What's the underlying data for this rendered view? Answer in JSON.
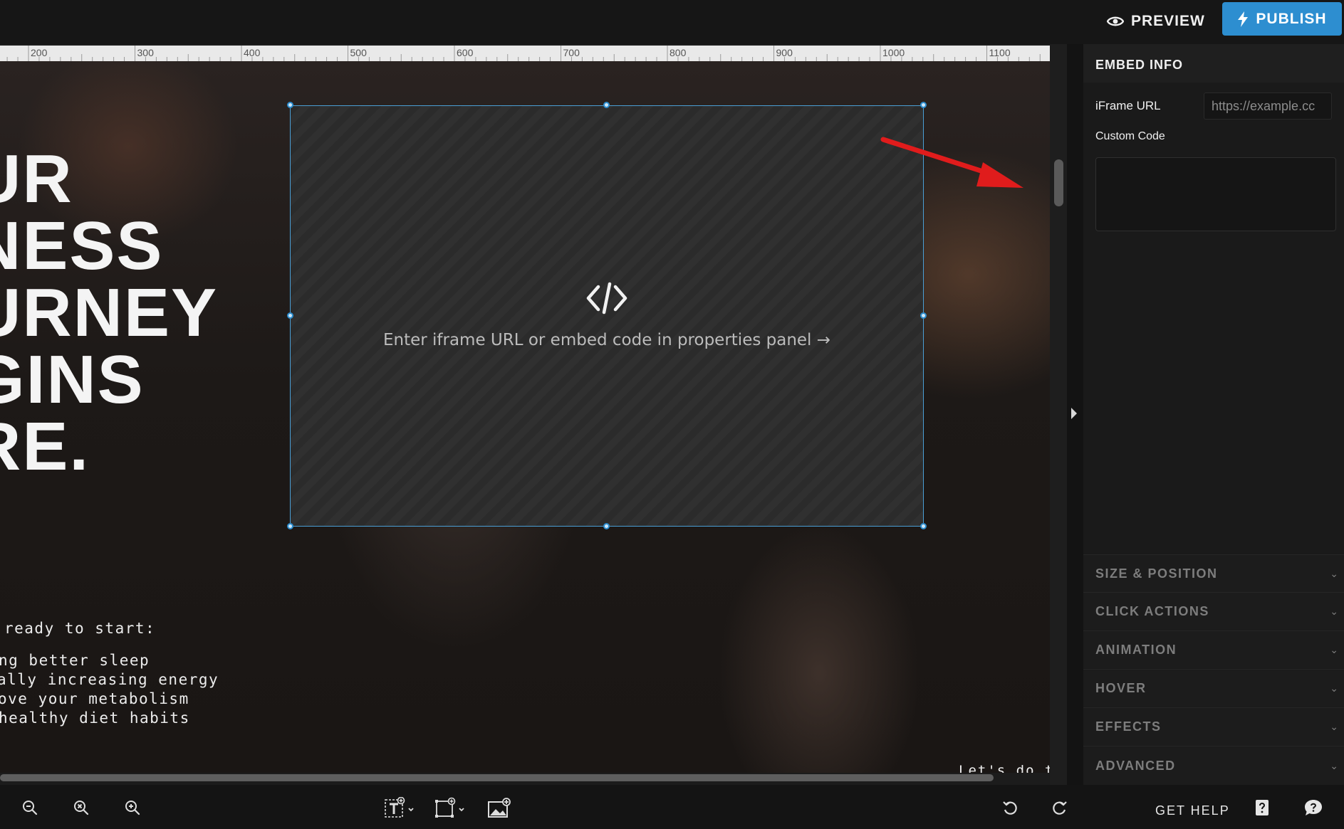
{
  "header": {
    "preview_label": "PREVIEW",
    "publish_label": "PUBLISH",
    "accent_color": "#2d8ed0"
  },
  "ruler": {
    "ticks": [
      "200",
      "300",
      "400",
      "500",
      "600",
      "700",
      "800",
      "900",
      "1000",
      "1100"
    ]
  },
  "canvas": {
    "hero_lines": [
      "UR",
      "NESS",
      "URNEY",
      "GINS",
      "RE."
    ],
    "intro_text": "ready to start:",
    "list_items": [
      "ng better sleep",
      "ally increasing energy",
      "ove your metabolism",
      "healthy diet habits"
    ],
    "bottom_text": "Let's do thi",
    "embed": {
      "icon": "code-icon",
      "placeholder_message": "Enter iframe URL or embed code in properties panel →"
    }
  },
  "properties_panel": {
    "title": "EMBED INFO",
    "iframe_url_label": "iFrame URL",
    "iframe_url_placeholder": "https://example.cc",
    "custom_code_label": "Custom Code",
    "sections": [
      "SIZE & POSITION",
      "CLICK ACTIONS",
      "ANIMATION",
      "HOVER",
      "EFFECTS",
      "ADVANCED"
    ]
  },
  "bottom_toolbar": {
    "get_help_label": "GET HELP",
    "tools": [
      "zoom-out-icon",
      "zoom-reset-icon",
      "zoom-in-icon",
      "add-text-icon",
      "add-shape-icon",
      "add-image-icon",
      "undo-icon",
      "redo-icon",
      "docs-icon",
      "chat-icon"
    ]
  }
}
